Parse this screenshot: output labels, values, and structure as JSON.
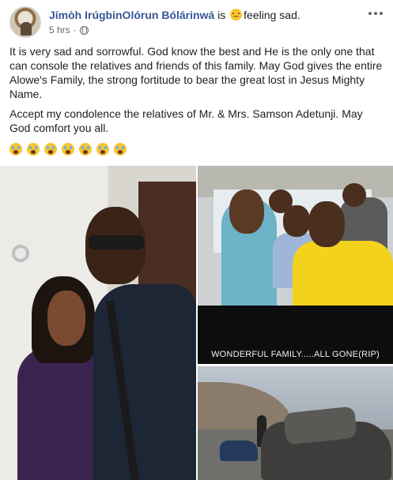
{
  "post": {
    "author": "Jímòh IrúgbinOlórun Bólárinwá",
    "is_text": "is",
    "feeling": "feeling sad.",
    "feeling_icon": "sad-face-icon",
    "time": "5 hrs",
    "dot": "·",
    "privacy_icon": "globe-icon",
    "paragraphs": [
      "It is very sad and sorrowful. God know the best and He is the only one that can console the relatives and friends of this family. May God gives the entire Alowe's Family, the strong fortitude to bear the great lost in Jesus Mighty Name.",
      "Accept my condolence the relatives of Mr. & Mrs. Samson Adetunji. May God comfort you all."
    ],
    "emoji_row": [
      "crying-face-icon",
      "crying-face-icon",
      "crying-face-icon",
      "crying-face-icon",
      "crying-face-icon",
      "crying-face-icon",
      "crying-face-icon"
    ]
  },
  "photos": {
    "caption": "WONDERFUL FAMILY.....ALL GONE(RIP)"
  },
  "colors": {
    "author_link": "#385898",
    "text": "#1c1e21",
    "meta": "#606770"
  }
}
